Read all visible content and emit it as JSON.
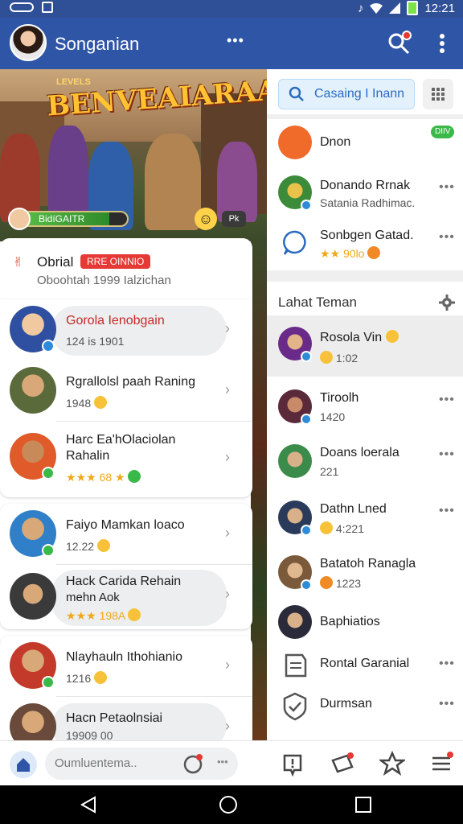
{
  "status_bar": {
    "time": "12:21"
  },
  "app_bar": {
    "title": "Songanian",
    "overflow": "•••"
  },
  "banner": {
    "game_title": "BENVEAIARAA!",
    "game_subtitle": "LEVELS",
    "player_progress_label": "BidíGAITR",
    "progress": 0.85,
    "tag_label": "Pk"
  },
  "left_panel": {
    "notification": {
      "name": "Obrial",
      "pill": "RRE OINNIO",
      "subtitle": "Oboohtah 1999 Ialzichan"
    },
    "rows": [
      {
        "title": "Gorola Ienobgain",
        "meta": "124 is 1901",
        "highlighted": true,
        "badge": "blue"
      },
      {
        "title": "Rgrallolsl paah Raning",
        "meta": "1948",
        "emoji": "yellow"
      },
      {
        "title": "Harc Ea'hOlaciolan",
        "title2": "Rahalin",
        "rating": "★★★ 68 ★",
        "emoji": "green",
        "badge": "green"
      },
      {
        "title": "Faiyo Mamkan loaco",
        "meta": "12.22",
        "emoji": "yellow",
        "badge": "green"
      },
      {
        "title": "Hack Carida Rehain",
        "title2": "mehn Aok",
        "rating": "★★★ 198A",
        "emoji": "yellow",
        "highlighted": true
      },
      {
        "title": "Nlayhauln Ithohianio",
        "meta": "1216",
        "emoji": "yellow",
        "badge": "green"
      },
      {
        "title": "Hacn Petaolnsiai",
        "meta": "19909 00",
        "highlighted": true
      }
    ]
  },
  "right_panel": {
    "search": {
      "placeholder": "Casaing I Inann"
    },
    "top_list": [
      {
        "title": "Dnon",
        "online_label": "DIIV"
      },
      {
        "title": "Donando Rrnak",
        "subtitle": "Satania Radhimac."
      },
      {
        "title": "Sonbgen Gatad.",
        "subtitle": "★★ 90lo"
      }
    ],
    "section_title": "Lahat Teman",
    "friends": [
      {
        "title": "Rosola Vin",
        "subtitle": "1:02",
        "selected": true
      },
      {
        "title": "Tiroolh",
        "subtitle": "1420"
      },
      {
        "title": "Doans loerala",
        "subtitle": "221"
      },
      {
        "title": "Dathn Lned",
        "subtitle": "4:221"
      },
      {
        "title": "Batatoh Ranagla",
        "subtitle": "1223"
      },
      {
        "title": "Baphiatios",
        "subtitle": ""
      },
      {
        "title": "Rontal Garanial",
        "subtitle": ""
      },
      {
        "title": "Durmsan",
        "subtitle": ""
      }
    ]
  },
  "bottom_bar": {
    "compose_placeholder": "Oumluentema.."
  },
  "colors": {
    "app_bar": "#2f56a6",
    "status_bar": "#2f4f97",
    "accent_red": "#e53935",
    "accent_green": "#3bb84a",
    "link_blue": "#2a6bbf"
  }
}
